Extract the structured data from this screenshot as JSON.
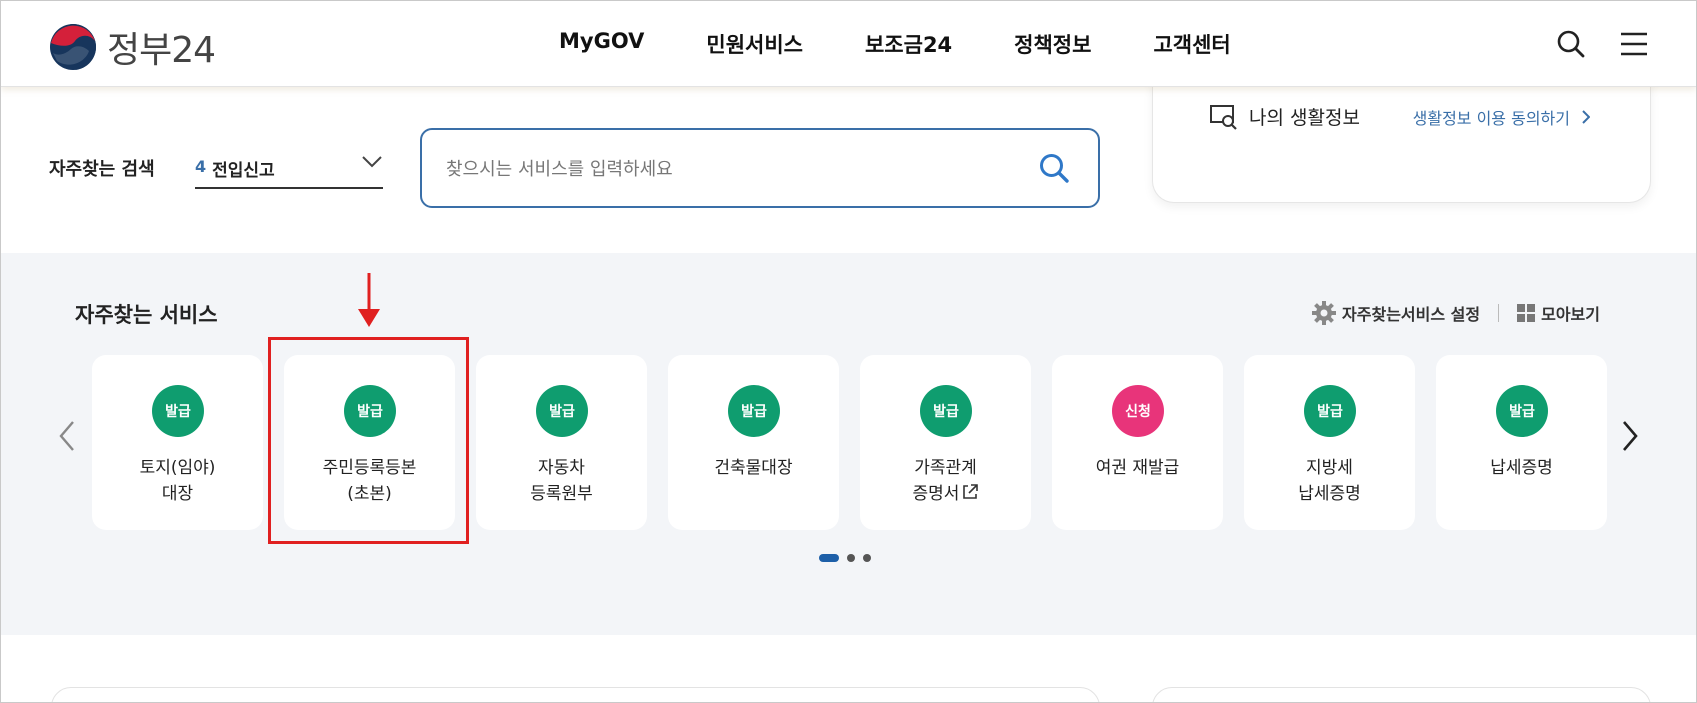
{
  "header": {
    "logo_text": "정부24",
    "nav": [
      "MyGOV",
      "민원서비스",
      "보조금24",
      "정책정보",
      "고객센터"
    ],
    "icons": [
      "search-icon",
      "menu-icon"
    ]
  },
  "search": {
    "label": "자주찾는 검색",
    "keyword_num": "4",
    "keyword": "전입신고",
    "placeholder": "찾으시는 서비스를 입력하세요"
  },
  "life": {
    "title": "나의 생활정보",
    "link": "생활정보 이용 동의하기"
  },
  "favorites": {
    "title": "자주찾는 서비스",
    "settings": "자주찾는서비스 설정",
    "view_all": "모아보기",
    "cards": [
      {
        "badge": "발급",
        "lines": [
          "토지(임야)",
          "대장"
        ],
        "type": "issue"
      },
      {
        "badge": "발급",
        "lines": [
          "주민등록등본",
          "(초본)"
        ],
        "type": "issue"
      },
      {
        "badge": "발급",
        "lines": [
          "자동차",
          "등록원부"
        ],
        "type": "issue"
      },
      {
        "badge": "발급",
        "lines": [
          "건축물대장"
        ],
        "type": "issue"
      },
      {
        "badge": "발급",
        "lines": [
          "가족관계",
          "증명서"
        ],
        "type": "issue",
        "external": true
      },
      {
        "badge": "신청",
        "lines": [
          "여권 재발급"
        ],
        "type": "apply"
      },
      {
        "badge": "발급",
        "lines": [
          "지방세",
          "납세증명"
        ],
        "type": "issue"
      },
      {
        "badge": "발급",
        "lines": [
          "납세증명"
        ],
        "type": "issue"
      }
    ],
    "page_count": 3,
    "active_page": 1
  },
  "colors": {
    "accent": "#3a6fa8",
    "issue_badge": "#0f9d6f",
    "apply_badge": "#e8347a",
    "highlight": "#e02020"
  }
}
